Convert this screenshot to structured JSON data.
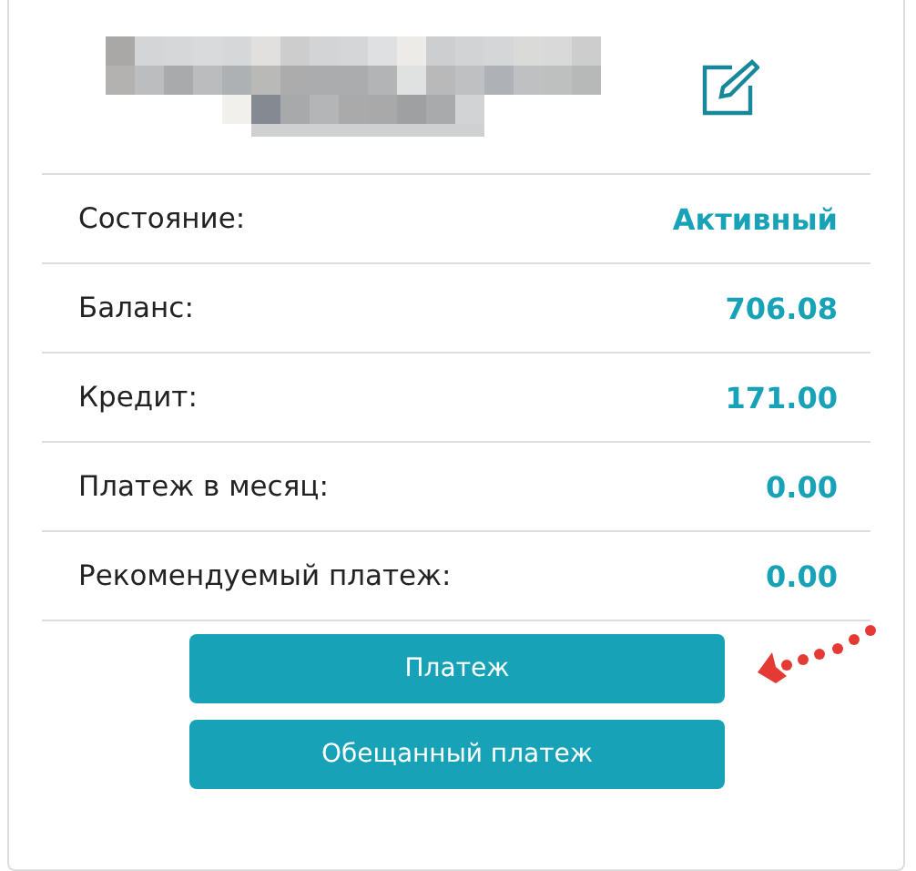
{
  "header": {
    "edit_button": {
      "kind": "icon"
    }
  },
  "rows": [
    {
      "label": "Состояние:",
      "value": "Активный"
    },
    {
      "label": "Баланс:",
      "value": "706.08"
    },
    {
      "label": "Кредит:",
      "value": "171.00"
    },
    {
      "label": "Платеж в месяц:",
      "value": "0.00"
    },
    {
      "label": "Рекомендуемый платеж:",
      "value": "0.00"
    }
  ],
  "buttons": [
    {
      "label": "Платеж",
      "pointed_at": true
    },
    {
      "label": "Обещанный платеж",
      "pointed_at": false
    }
  ]
}
